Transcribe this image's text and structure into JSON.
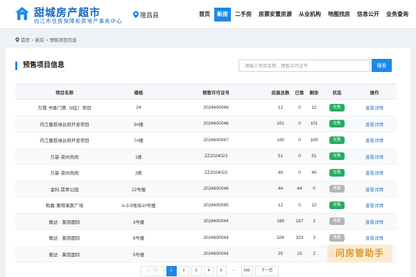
{
  "brand": {
    "title": "甜城房产超市",
    "subtitle": "内江市住房保障和房地产事务中心",
    "logo_color": "#1e88e5"
  },
  "location": {
    "label": "隆昌县",
    "icon": "map-pin-icon"
  },
  "nav": {
    "items": [
      {
        "label": "首页",
        "active": false
      },
      {
        "label": "新房",
        "active": true
      },
      {
        "label": "二手房",
        "active": false
      },
      {
        "label": "房票安置房源",
        "active": false
      },
      {
        "label": "从业机构",
        "active": false
      },
      {
        "label": "地图找房",
        "active": false
      },
      {
        "label": "信息公开",
        "active": false
      },
      {
        "label": "业务查询",
        "active": false
      }
    ]
  },
  "breadcrumb": {
    "items": [
      "首页",
      "新房",
      "预售项目信息"
    ],
    "separator": ">"
  },
  "section": {
    "title": "预售项目信息"
  },
  "search": {
    "placeholder": "请输入项目名称、预售许可证号",
    "button": "搜索"
  },
  "table": {
    "headers": [
      "项目名称",
      "楼栋",
      "销售许可证号",
      "房屋总数",
      "已售",
      "剩余",
      "状态",
      "操作"
    ],
    "rows": [
      {
        "name": "万晟·书香门第（8区）项目",
        "building": "24",
        "license": "2024600049",
        "total": "12",
        "sold": "0",
        "remaining": "12",
        "status": "在售",
        "on_sale": true,
        "action": "查看详情"
      },
      {
        "name": "内江嘉投绿台府开发项目",
        "building": "9#楼",
        "license": "2024600048",
        "total": "101",
        "sold": "0",
        "remaining": "101",
        "status": "在售",
        "on_sale": true,
        "action": "查看详情"
      },
      {
        "name": "内江嘉投绿台府开发项目",
        "building": "7#楼",
        "license": "2024600047",
        "total": "100",
        "sold": "0",
        "remaining": "100",
        "status": "在售",
        "on_sale": true,
        "action": "查看详情"
      },
      {
        "name": "万基·资州尚府",
        "building": "1栋",
        "license": "ZZ2024023",
        "total": "51",
        "sold": "0",
        "remaining": "51",
        "status": "在售",
        "on_sale": true,
        "action": "查看详情"
      },
      {
        "name": "万基·资州尚府",
        "building": "2栋",
        "license": "ZZ2024022",
        "total": "40",
        "sold": "0",
        "remaining": "40",
        "status": "在售",
        "on_sale": true,
        "action": "查看详情"
      },
      {
        "name": "金科.翡翠公园",
        "building": "22号楼",
        "license": "2024600046",
        "total": "44",
        "sold": "44",
        "remaining": "0",
        "status": "售罄",
        "on_sale": false,
        "action": "查看详情"
      },
      {
        "name": "和嘉·東特莱斯广场",
        "building": "A-3-5地块10号楼",
        "license": "2024600045",
        "total": "12",
        "sold": "0",
        "remaining": "12",
        "status": "在售",
        "on_sale": true,
        "action": "查看详情"
      },
      {
        "name": "衡达 · 莱茵国际",
        "building": "3号楼",
        "license": "2024600044",
        "total": "189",
        "sold": "187",
        "remaining": "2",
        "status": "售罄",
        "on_sale": false,
        "action": "查看详情"
      },
      {
        "name": "衡达 · 莱茵国际",
        "building": "6号楼",
        "license": "2024600044",
        "total": "326",
        "sold": "323",
        "remaining": "3",
        "status": "售罄",
        "on_sale": false,
        "action": "查看详情"
      },
      {
        "name": "衡达 · 莱茵国际",
        "building": "5号楼",
        "license": "2024600044",
        "total": "25",
        "sold": "23",
        "remaining": "2",
        "status": "售罄",
        "on_sale": false,
        "action": "查看详情"
      }
    ]
  },
  "pagination": {
    "prev": "上一页",
    "pages": [
      "1",
      "2",
      "3",
      "4",
      "5",
      "...",
      "590"
    ],
    "current": "1",
    "next": "下一页"
  },
  "watermark": {
    "text": "问房管助手"
  },
  "colors": {
    "accent": "#1e88e5",
    "on_sale": "#27ae60",
    "sold_out": "#b5b5b5",
    "link": "#2b7cd3"
  }
}
